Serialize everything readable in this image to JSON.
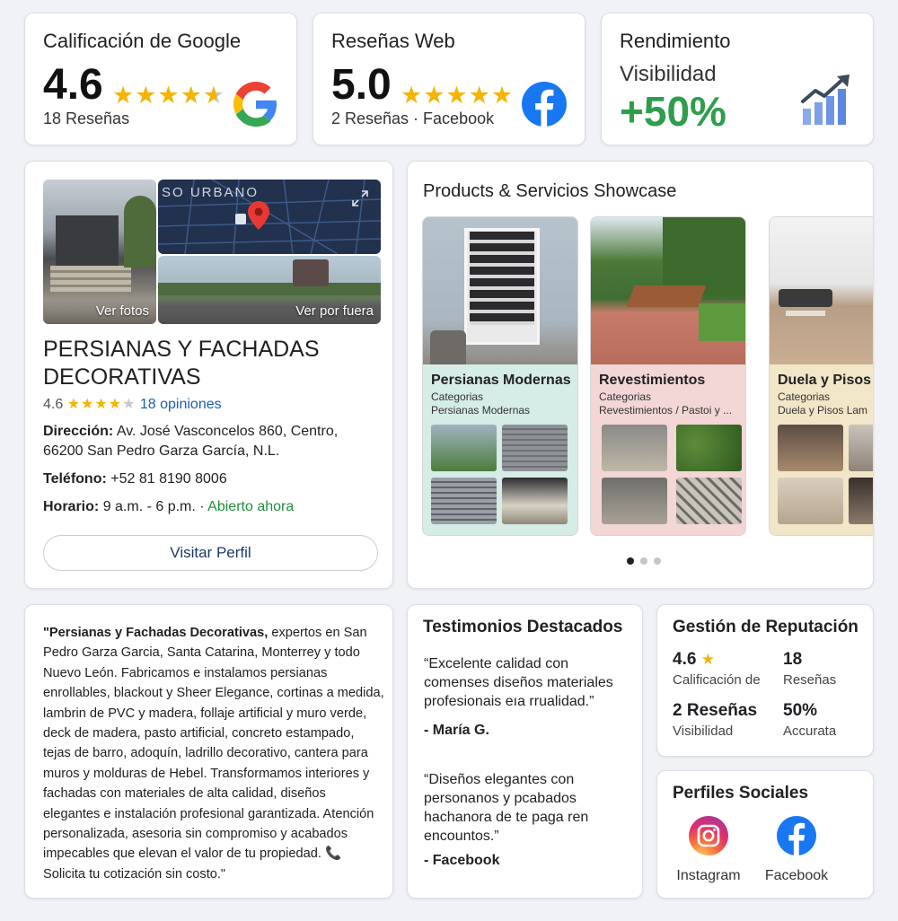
{
  "google": {
    "title": "Calificación de Google",
    "rating": "4.6",
    "reviews": "18 Reseñas"
  },
  "web": {
    "title": "Reseñas Web",
    "rating": "5.0",
    "reviews": "2 Reseñas · Facebook"
  },
  "performance": {
    "title": "Rendimiento",
    "metric_label": "Visibilidad",
    "metric_value": "+50%"
  },
  "business": {
    "photo_label_1": "Ver fotos",
    "photo_label_2": "Ver por fuera",
    "map_label": "SO URBANO",
    "name": "PERSIANAS Y FACHADAS DECORATIVAS",
    "rating": "4.6",
    "reviews_link": "18 opiniones",
    "address_label": "Dirección:",
    "address": "Av. José Vasconcelos 860, Centro, 66200 San Pedro Garza García, N.L.",
    "phone_label": "Teléfono:",
    "phone": "+52 81 8190 8006",
    "hours_label": "Horario:",
    "hours": "9 a.m. - 6 p.m.",
    "hours_sep": " · ",
    "open_status": "Abierto ahora",
    "visit_button": "Visitar Perfil"
  },
  "showcase": {
    "title": "Products & Servicios Showcase",
    "products": [
      {
        "name": "Persianas Modernas",
        "cat_label": "Categorias",
        "cat_value": "Persianas Modernas"
      },
      {
        "name": "Revestimientos",
        "cat_label": "Categorias",
        "cat_value": "Revestimientos / Pastoi y ..."
      },
      {
        "name": "Duela y Pisos",
        "cat_label": "Categorias",
        "cat_value": "Duela y Pisos Lam"
      }
    ]
  },
  "about": {
    "lead_bold": "\"Persianas y Fachadas Decorativas,",
    "text": " expertos en San Pedro Garza Garcia, Santa Catarina, Monterrey y todo Nuevo León. Fabricamos e instalamos persianas enrollables, blackout y Sheer Elegance, cortinas a medida, lambrin de PVC y madera, follaje artificial y muro verde, deck de madera, pasto artificial, concreto estampado, tejas de barro, adoquín, ladrillo decorativo, cantera para muros y molduras de Hebel. Transformamos interiores y fachadas con materiales de alta calidad, diseños elegantes e instalación profesional garantizada. Atención personalizada, asesoria sin compromiso y acabados impecables que elevan el valor de tu propiedad. ",
    "phone_emoji": "📞",
    "closing": " Solicita tu cotización sin costo.\""
  },
  "testimonials": {
    "title": "Testimonios Destacados",
    "items": [
      {
        "quote": "“Excelente calidad con comenses diseños materiales profesionais eıa rrualidad.”",
        "author": "- María G."
      },
      {
        "quote": "“Diseños elegantes con personanos y pcabados hachanora de te paga ren encountos.”",
        "author": "- Facebook"
      }
    ]
  },
  "reputation": {
    "title": "Gestión de Reputación",
    "rating": "4.6",
    "rating_label": "Calificación de",
    "reviews_count": "18",
    "reviews_label": "Reseñas",
    "web_reviews": "2 Reseñas",
    "visibility_label": "Visibilidad",
    "pct": "50%",
    "pct_label": "Accurata"
  },
  "social": {
    "title": "Perfiles Sociales",
    "instagram": "Instagram",
    "facebook": "Facebook"
  },
  "colors": {
    "star": "#f4b400",
    "green": "#2e9e4c",
    "link": "#1a5fb4",
    "facebook": "#1877f2"
  }
}
